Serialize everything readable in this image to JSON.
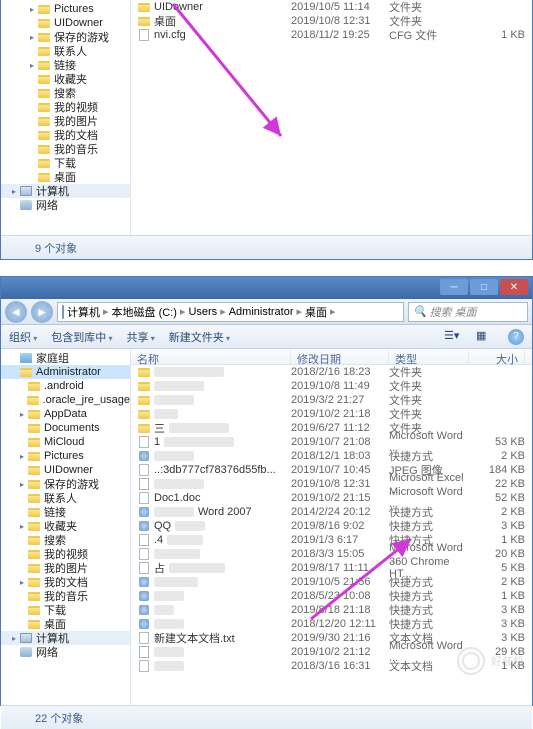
{
  "win1": {
    "tree": [
      {
        "icon": "folder",
        "label": "Pictures",
        "exp": "▸",
        "lvl": 2
      },
      {
        "icon": "folder",
        "label": "UIDowner",
        "exp": "",
        "lvl": 2
      },
      {
        "icon": "folder",
        "label": "保存的游戏",
        "exp": "▸",
        "lvl": 2
      },
      {
        "icon": "folder",
        "label": "联系人",
        "exp": "",
        "lvl": 2
      },
      {
        "icon": "folder",
        "label": "链接",
        "exp": "▸",
        "lvl": 2
      },
      {
        "icon": "folder",
        "label": "收藏夹",
        "exp": "",
        "lvl": 2
      },
      {
        "icon": "folder",
        "label": "搜索",
        "exp": "",
        "lvl": 2
      },
      {
        "icon": "folder",
        "label": "我的视频",
        "exp": "",
        "lvl": 2
      },
      {
        "icon": "folder",
        "label": "我的图片",
        "exp": "",
        "lvl": 2
      },
      {
        "icon": "folder",
        "label": "我的文档",
        "exp": "",
        "lvl": 2
      },
      {
        "icon": "folder",
        "label": "我的音乐",
        "exp": "",
        "lvl": 2
      },
      {
        "icon": "folder",
        "label": "下载",
        "exp": "",
        "lvl": 2
      },
      {
        "icon": "folder",
        "label": "桌面",
        "exp": "",
        "lvl": 2
      },
      {
        "icon": "comp",
        "label": "计算机",
        "exp": "▸",
        "lvl": 0,
        "bg": "#e6eef8"
      },
      {
        "icon": "net",
        "label": "网络",
        "exp": "",
        "lvl": 0
      }
    ],
    "rows": [
      {
        "icon": "folder",
        "name": "UIDowner",
        "date": "2019/10/5 11:14",
        "type": "文件夹",
        "size": ""
      },
      {
        "icon": "folder",
        "name": "桌面",
        "date": "2019/10/8 12:31",
        "type": "文件夹",
        "size": ""
      },
      {
        "icon": "file",
        "name": "nvi.cfg",
        "blurpart": "nvi",
        "date": "2018/11/2 19:25",
        "type": "CFG 文件",
        "size": "1 KB"
      }
    ],
    "status": "9 个对象"
  },
  "win2": {
    "address": [
      "计算机",
      "本地磁盘 (C:)",
      "Users",
      "Administrator",
      "桌面"
    ],
    "search_placeholder": "搜索 桌面",
    "toolbar": {
      "org": "组织",
      "include": "包含到库中",
      "share": "共享",
      "new": "新建文件夹"
    },
    "columns": {
      "name": "名称",
      "date": "修改日期",
      "type": "类型",
      "size": "大小"
    },
    "tree": [
      {
        "icon": "lib",
        "label": "家庭组",
        "exp": "",
        "lvl": 0
      },
      {
        "icon": "folder",
        "label": "Administrator",
        "exp": "",
        "lvl": 0,
        "sel": true
      },
      {
        "icon": "folder",
        "label": ".android",
        "exp": "",
        "lvl": 1
      },
      {
        "icon": "folder",
        "label": ".oracle_jre_usage",
        "exp": "",
        "lvl": 1
      },
      {
        "icon": "folder",
        "label": "AppData",
        "exp": "▸",
        "lvl": 1
      },
      {
        "icon": "folder",
        "label": "Documents",
        "exp": "",
        "lvl": 1
      },
      {
        "icon": "folder",
        "label": "MiCloud",
        "exp": "",
        "lvl": 1
      },
      {
        "icon": "folder",
        "label": "Pictures",
        "exp": "▸",
        "lvl": 1
      },
      {
        "icon": "folder",
        "label": "UIDowner",
        "exp": "",
        "lvl": 1
      },
      {
        "icon": "folder",
        "label": "保存的游戏",
        "exp": "▸",
        "lvl": 1
      },
      {
        "icon": "folder",
        "label": "联系人",
        "exp": "",
        "lvl": 1
      },
      {
        "icon": "folder",
        "label": "链接",
        "exp": "",
        "lvl": 1
      },
      {
        "icon": "folder",
        "label": "收藏夹",
        "exp": "▸",
        "lvl": 1
      },
      {
        "icon": "folder",
        "label": "搜索",
        "exp": "",
        "lvl": 1
      },
      {
        "icon": "folder",
        "label": "我的视频",
        "exp": "",
        "lvl": 1
      },
      {
        "icon": "folder",
        "label": "我的图片",
        "exp": "",
        "lvl": 1
      },
      {
        "icon": "folder",
        "label": "我的文档",
        "exp": "▸",
        "lvl": 1
      },
      {
        "icon": "folder",
        "label": "我的音乐",
        "exp": "",
        "lvl": 1
      },
      {
        "icon": "folder",
        "label": "下载",
        "exp": "",
        "lvl": 1
      },
      {
        "icon": "folder",
        "label": "桌面",
        "exp": "",
        "lvl": 1
      },
      {
        "icon": "comp",
        "label": "计算机",
        "exp": "▸",
        "lvl": 0,
        "bg": "#e6eef8"
      },
      {
        "icon": "net",
        "label": "网络",
        "exp": "",
        "lvl": 0
      }
    ],
    "rows": [
      {
        "icon": "folder",
        "blurw": 70,
        "name": "",
        "date": "2018/2/16 18:23",
        "type": "文件夹",
        "size": ""
      },
      {
        "icon": "folder",
        "blurw": 50,
        "name": "",
        "date": "2019/10/8 11:49",
        "type": "文件夹",
        "size": ""
      },
      {
        "icon": "folder",
        "blurw": 40,
        "name": "",
        "date": "2019/3/2 21:27",
        "type": "文件夹",
        "size": ""
      },
      {
        "icon": "folder",
        "blurw": 24,
        "name": "",
        "date": "2019/10/2 21:18",
        "type": "文件夹",
        "size": ""
      },
      {
        "icon": "folder",
        "name": "三",
        "blurw": 60,
        "date": "2019/6/27 11:12",
        "type": "文件夹",
        "size": ""
      },
      {
        "icon": "file",
        "name": "1",
        "blurw": 70,
        "date": "2019/10/7 21:08",
        "type": "Microsoft Word ...",
        "size": "53 KB"
      },
      {
        "icon": "link",
        "blurw": 40,
        "name": "",
        "date": "2018/12/1 18:03",
        "type": "快捷方式",
        "size": "2 KB"
      },
      {
        "icon": "file",
        "name": "..:3db777cf78376d55fb...",
        "date": "2019/10/7 10:45",
        "type": "JPEG 图像",
        "size": "184 KB"
      },
      {
        "icon": "file",
        "blurw": 50,
        "name": "",
        "date": "2019/10/8 12:31",
        "type": "Microsoft Excel ...",
        "size": "22 KB"
      },
      {
        "icon": "file",
        "name": "Doc1.doc",
        "blurpart": "Doc1",
        "date": "2019/10/2 21:15",
        "type": "Microsoft Word ...",
        "size": "52 KB"
      },
      {
        "icon": "link",
        "name": "Word 2007",
        "preblur": 40,
        "date": "2014/2/24 20:12",
        "type": "快捷方式",
        "size": "2 KB"
      },
      {
        "icon": "link",
        "name": "QQ",
        "blurw": 30,
        "date": "2019/8/16 9:02",
        "type": "快捷方式",
        "size": "3 KB"
      },
      {
        "icon": "file",
        "blurw": 36,
        "name": ".4",
        "date": "2019/1/3 6:17",
        "type": "快捷方式",
        "size": "1 KB"
      },
      {
        "icon": "file",
        "blurw": 46,
        "name": "",
        "date": "2018/3/3 15:05",
        "type": "Microsoft Word ...",
        "size": "20 KB"
      },
      {
        "icon": "file",
        "blurw": 56,
        "name": "占",
        "date": "2019/8/17 11:11",
        "type": "360 Chrome HT...",
        "size": "5 KB"
      },
      {
        "icon": "link",
        "blurw": 44,
        "name": "",
        "date": "2019/10/5 21:56",
        "type": "快捷方式",
        "size": "2 KB"
      },
      {
        "icon": "link",
        "blurw": 30,
        "name": "",
        "date": "2018/5/23 10:08",
        "type": "快捷方式",
        "size": "1 KB"
      },
      {
        "icon": "link",
        "blurw": 20,
        "name": "",
        "date": "2019/8/18 21:18",
        "type": "快捷方式",
        "size": "3 KB"
      },
      {
        "icon": "link",
        "blurw": 30,
        "name": "",
        "date": "2018/12/20 12:11",
        "type": "快捷方式",
        "size": "3 KB"
      },
      {
        "icon": "file",
        "name": "新建文本文档.txt",
        "date": "2019/9/30 21:16",
        "type": "文本文档",
        "size": "3 KB"
      },
      {
        "icon": "file",
        "blurw": 30,
        "name": "",
        "date": "2019/10/2 21:12",
        "type": "Microsoft Word ...",
        "size": "29 KB"
      },
      {
        "icon": "file",
        "blurw": 30,
        "name": "",
        "date": "2018/3/16 16:31",
        "type": "文本文档",
        "size": "1 KB"
      }
    ],
    "status": "22 个对象",
    "watermark": "好装机"
  }
}
